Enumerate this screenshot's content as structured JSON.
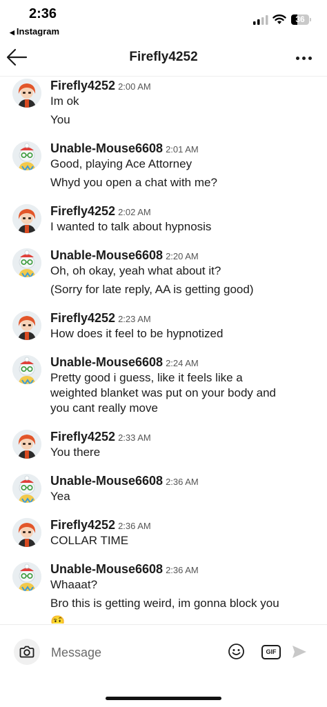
{
  "status_bar": {
    "time": "2:36",
    "back_app": "Instagram",
    "battery": "36"
  },
  "header": {
    "title": "Firefly4252"
  },
  "users": {
    "firefly": {
      "name": "Firefly4252",
      "colors": {
        "hair": "#e2562a",
        "shirt": "#2b2b2b",
        "bg": "#e9eef1"
      }
    },
    "mouse": {
      "name": "Unable-Mouse6608",
      "colors": {
        "hat": "#e0403a",
        "glasses": "#3a9a3a",
        "shirt": "#f2c94c",
        "bg": "#e9eef1"
      }
    }
  },
  "messages": [
    {
      "user": "firefly",
      "name": "Firefly4252",
      "time": "2:00 AM",
      "lines": [
        "Im ok",
        "You"
      ]
    },
    {
      "user": "mouse",
      "name": "Unable-Mouse6608",
      "time": "2:01 AM",
      "lines": [
        "Good, playing Ace Attorney",
        "Whyd you open a chat with me?"
      ]
    },
    {
      "user": "firefly",
      "name": "Firefly4252",
      "time": "2:02 AM",
      "lines": [
        "I wanted to talk about hypnosis"
      ]
    },
    {
      "user": "mouse",
      "name": "Unable-Mouse6608",
      "time": "2:20 AM",
      "lines": [
        "Oh, oh okay, yeah what about it?",
        "(Sorry for late reply, AA is getting good)"
      ]
    },
    {
      "user": "firefly",
      "name": "Firefly4252",
      "time": "2:23 AM",
      "lines": [
        "How does it feel to be hypnotized"
      ]
    },
    {
      "user": "mouse",
      "name": "Unable-Mouse6608",
      "time": "2:24 AM",
      "lines": [
        "Pretty good i guess, like it feels like a",
        "weighted blanket was put on your body and",
        "you cant really move"
      ]
    },
    {
      "user": "firefly",
      "name": "Firefly4252",
      "time": "2:33 AM",
      "lines": [
        "You there"
      ]
    },
    {
      "user": "mouse",
      "name": "Unable-Mouse6608",
      "time": "2:36 AM",
      "lines": [
        "Yea"
      ]
    },
    {
      "user": "firefly",
      "name": "Firefly4252",
      "time": "2:36 AM",
      "lines": [
        "COLLAR TIME"
      ]
    },
    {
      "user": "mouse",
      "name": "Unable-Mouse6608",
      "time": "2:36 AM",
      "lines": [
        "Whaaat?",
        "Bro this is getting weird, im gonna block you",
        "🤨"
      ]
    }
  ],
  "composer": {
    "placeholder": "Message",
    "gif_label": "GIF"
  }
}
